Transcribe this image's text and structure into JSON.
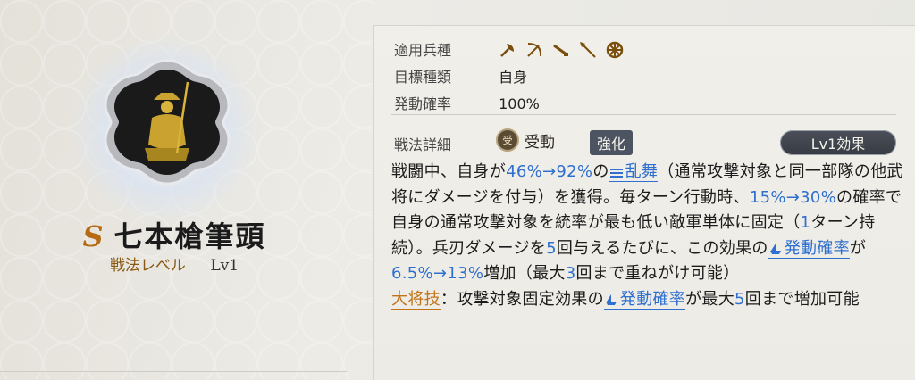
{
  "skill": {
    "grade": "S",
    "name": "七本槍筆頭",
    "level_label": "戦法レベル",
    "level_value": "Lv1"
  },
  "info": {
    "troop_label": "適用兵種",
    "troop_icons": [
      "axe-icon",
      "bow-icon",
      "gun-icon",
      "spear-icon",
      "wheel-icon"
    ],
    "target_label": "目標種類",
    "target_value": "自身",
    "rate_label": "発動確率",
    "rate_value": "100%"
  },
  "detail": {
    "label": "戦法詳細",
    "passive_badge": "受",
    "passive_label": "受動",
    "enhance_label": "強化",
    "level_button": "Lv1効果",
    "segments": [
      "戦闘中、自身が",
      "46%→92%",
      "の",
      "乱舞",
      "（通常攻撃対象と同一部隊の他武将にダメージを付与）を獲得。毎ターン行動時、",
      "15%→30%",
      "の確率で自身の通常攻撃対象を統率が最も低い敵軍単体に固定（",
      "1",
      "ターン持続）。兵刃ダメージを",
      "5",
      "回与えるたびに、この効果の",
      "発動確率",
      "が",
      "6.5%→13%",
      "増加（最大",
      "3",
      "回まで重ねがけ可能）",
      "大将技",
      "：攻撃対象固定効果の",
      "発動確率",
      "が最大",
      "5",
      "回まで増加可能"
    ]
  },
  "colors": {
    "accent_blue": "#2e6fd0",
    "accent_gold": "#c37316",
    "label_brown": "#8a5a15"
  }
}
